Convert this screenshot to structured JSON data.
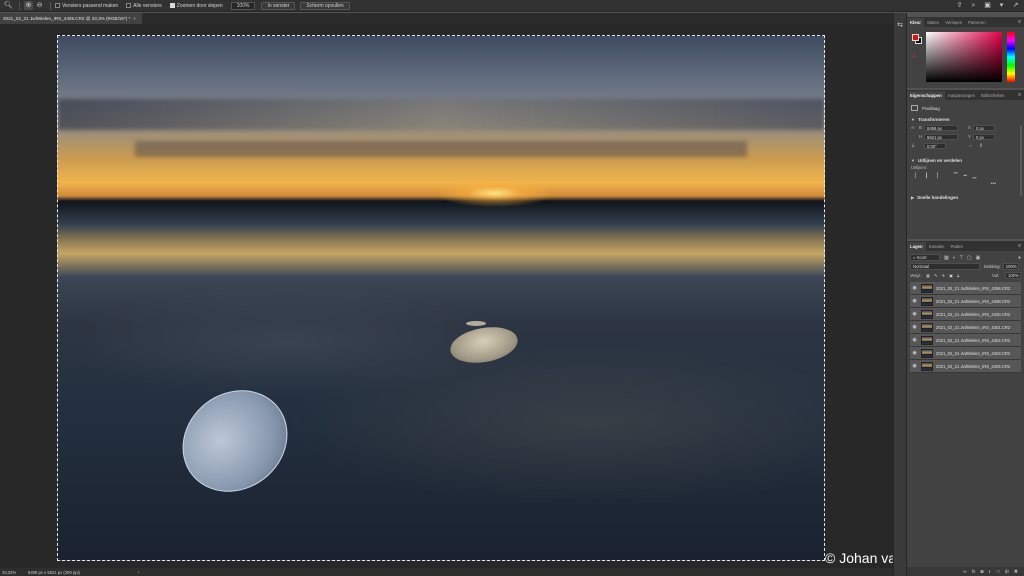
{
  "options_bar": {
    "fit_windows_label": "Vensters passend maken",
    "all_windows_label": "Alle vensters",
    "scrubby_zoom_label": "Zoomen door slepen",
    "zoom_value": "100%",
    "fit_screen_button": "In venster",
    "fill_screen_button": "Scherm opvullen"
  },
  "document_tab": {
    "title": "2021_02_21 JvdWielen_IRS_4405.CR2 @ 33,3% (RGB/16*) *",
    "close": "×"
  },
  "watermark": "© Johan van der Wielen",
  "status_bar": {
    "zoom": "33,33%",
    "dimensions": "8499 px x 5621 px (300 ppi)",
    "arrow": "›"
  },
  "kleur_panel": {
    "tabs": [
      "Kleur",
      "Stalen",
      "Verlopen",
      "Patronen"
    ]
  },
  "eigenschappen_panel": {
    "tabs": [
      "Eigenschappen",
      "Aanpassingen",
      "Bibliotheken"
    ],
    "layer_type": "Pixellaag",
    "transform_heading": "Transformeren",
    "w_label": "B",
    "w_value": "8499 px",
    "h_label": "H",
    "h_value": "5621 px",
    "x_label": "X",
    "x_value": "0 px",
    "y_label": "Y",
    "y_value": "0 px",
    "angle_value": "0,00°",
    "align_heading": "Uitlijnen en verdelen",
    "align_sub": "Uitlijnen:",
    "more": "•••",
    "quick_actions_heading": "Snelle handelingen"
  },
  "lagen_panel": {
    "tabs": [
      "Lagen",
      "Kanalen",
      "Paden"
    ],
    "filter_label": "Soort",
    "blend_mode": "Normaal",
    "opacity_label": "Dekking:",
    "opacity_value": "100%",
    "lock_label": "Vergr.:",
    "fill_label": "Vul:",
    "fill_value": "100%",
    "layers": [
      "2021_02_21 JvdWielen_IRS_4396.CR2",
      "2021_02_21 JvdWielen_IRS_4398.CR2",
      "2021_02_21 JvdWielen_IRS_4400.CR2",
      "2021_02_21 JvdWielen_IRS_4401.CR2",
      "2021_02_21 JvdWielen_IRS_4402.CR2",
      "2021_02_21 JvdWielen_IRS_4403.CR2",
      "2021_02_21 JvdWielen_IRS_4405.CR2"
    ]
  },
  "colors": {
    "foreground": "#e01010",
    "background": "#111111",
    "panel": "#424242",
    "canvas_bg": "#282828"
  }
}
